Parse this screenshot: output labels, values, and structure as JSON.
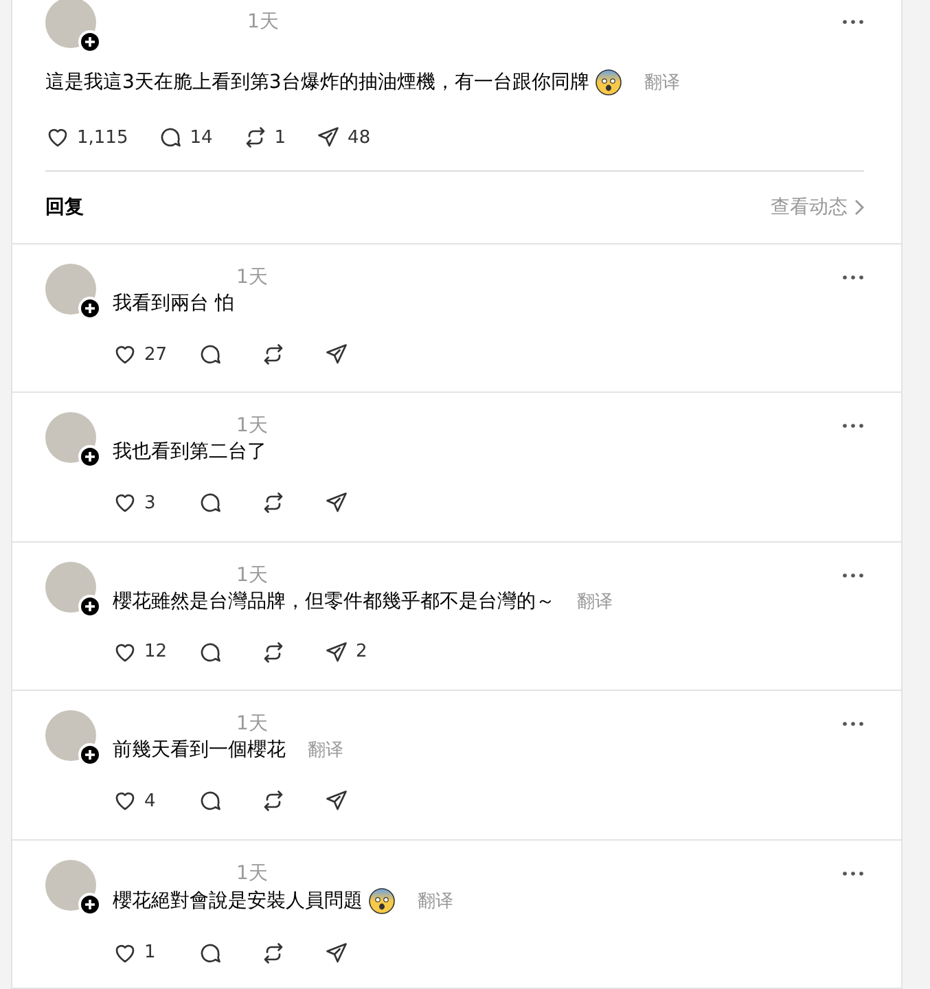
{
  "post": {
    "time": "1天",
    "text": "這是我這3天在脆上看到第3台爆炸的抽油煙機，有一台跟你同牌",
    "emoji": true,
    "translate": "翻译",
    "stats": {
      "likes": "1,115",
      "comments": "14",
      "reposts": "1",
      "shares": "48"
    },
    "reply_label": "回复",
    "activity_link": "查看动态"
  },
  "replies": [
    {
      "time": "1天",
      "text": "我看到兩台 怕",
      "likes": "27"
    },
    {
      "time": "1天",
      "text": "我也看到第二台了",
      "likes": "3"
    },
    {
      "time": "1天",
      "text": "櫻花雖然是台灣品牌，但零件都幾乎都不是台灣的～",
      "translate": "翻译",
      "likes": "12",
      "shares": "2"
    },
    {
      "time": "1天",
      "text": "前幾天看到一個櫻花",
      "translate": "翻译",
      "likes": "4"
    },
    {
      "time": "1天",
      "text": "櫻花絕對會說是安裝人員問題",
      "emoji": true,
      "translate": "翻译",
      "likes": "1"
    }
  ]
}
